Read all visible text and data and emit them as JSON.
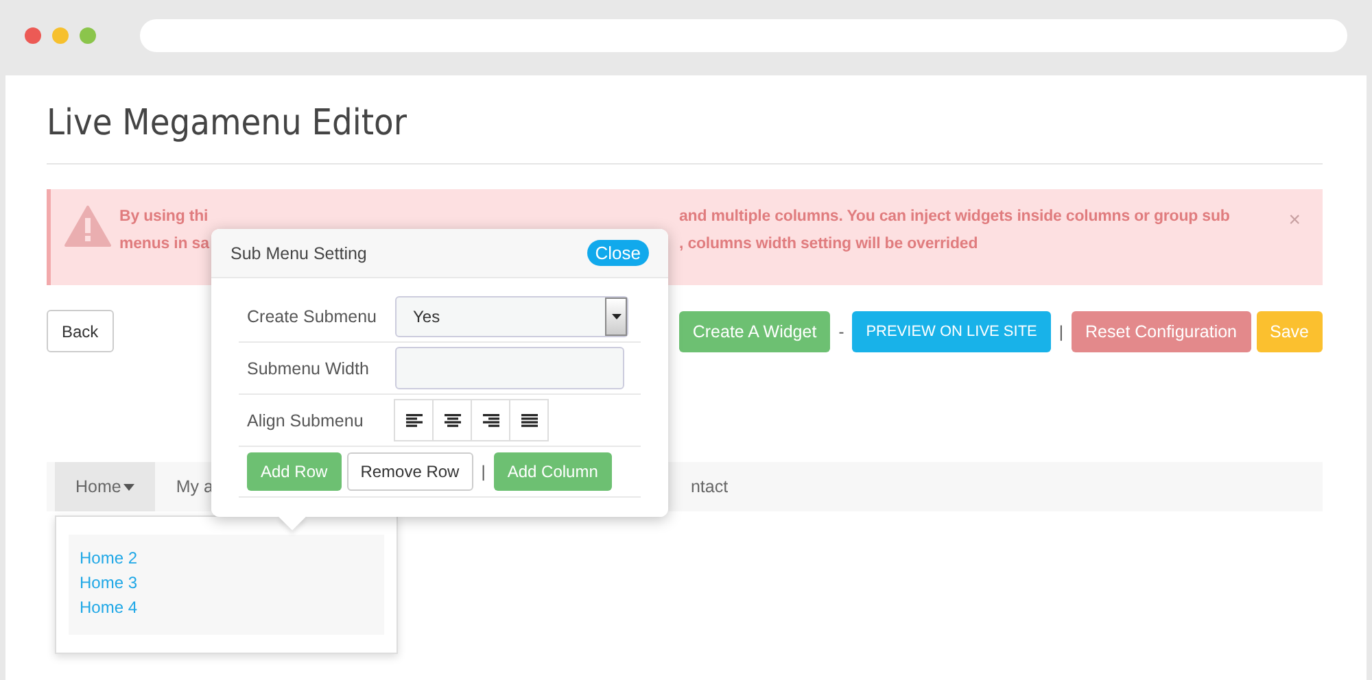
{
  "page": {
    "title": "Live Megamenu Editor"
  },
  "alert": {
    "lines": [
      {
        "left": "By using thi",
        "right": "and multiple columns. You can inject widgets inside columns or group sub"
      },
      {
        "left": "menus in sa",
        "right": ", columns width setting will be overrided"
      }
    ],
    "close": "×"
  },
  "toolbar": {
    "back": "Back",
    "buttons": [
      {
        "label": "Create A Widget",
        "kind": "success"
      },
      {
        "label": "-",
        "kind": "sep"
      },
      {
        "label": "PREVIEW ON LIVE SITE",
        "kind": "info"
      },
      {
        "label": "|",
        "kind": "sep"
      },
      {
        "label": "Reset Configuration",
        "kind": "danger"
      },
      {
        "label": "Save",
        "kind": "warning"
      }
    ]
  },
  "nav": {
    "items": [
      {
        "label": "Home",
        "selected": true,
        "caret": true
      },
      {
        "label": "My a",
        "selected": false,
        "caret": false
      },
      {
        "label": "ntact",
        "selected": false,
        "caret": false
      }
    ],
    "dropdown": [
      {
        "label": "Home 2"
      },
      {
        "label": "Home 3"
      },
      {
        "label": "Home 4"
      }
    ]
  },
  "popup": {
    "title": "Sub Menu Setting",
    "close": "Close",
    "create_submenu": {
      "label": "Create Submenu",
      "value": "Yes"
    },
    "submenu_width": {
      "label": "Submenu Width"
    },
    "align": {
      "label": "Align Submenu",
      "options": [
        {
          "kind": "left"
        },
        {
          "kind": "center"
        },
        {
          "kind": "right"
        },
        {
          "kind": "justify"
        }
      ]
    },
    "actions": [
      {
        "label": "Add Row",
        "kind": "success"
      },
      {
        "label": "Remove Row",
        "kind": "default"
      },
      {
        "label": "|",
        "kind": "sep"
      },
      {
        "label": "Add Column",
        "kind": "success"
      }
    ]
  }
}
